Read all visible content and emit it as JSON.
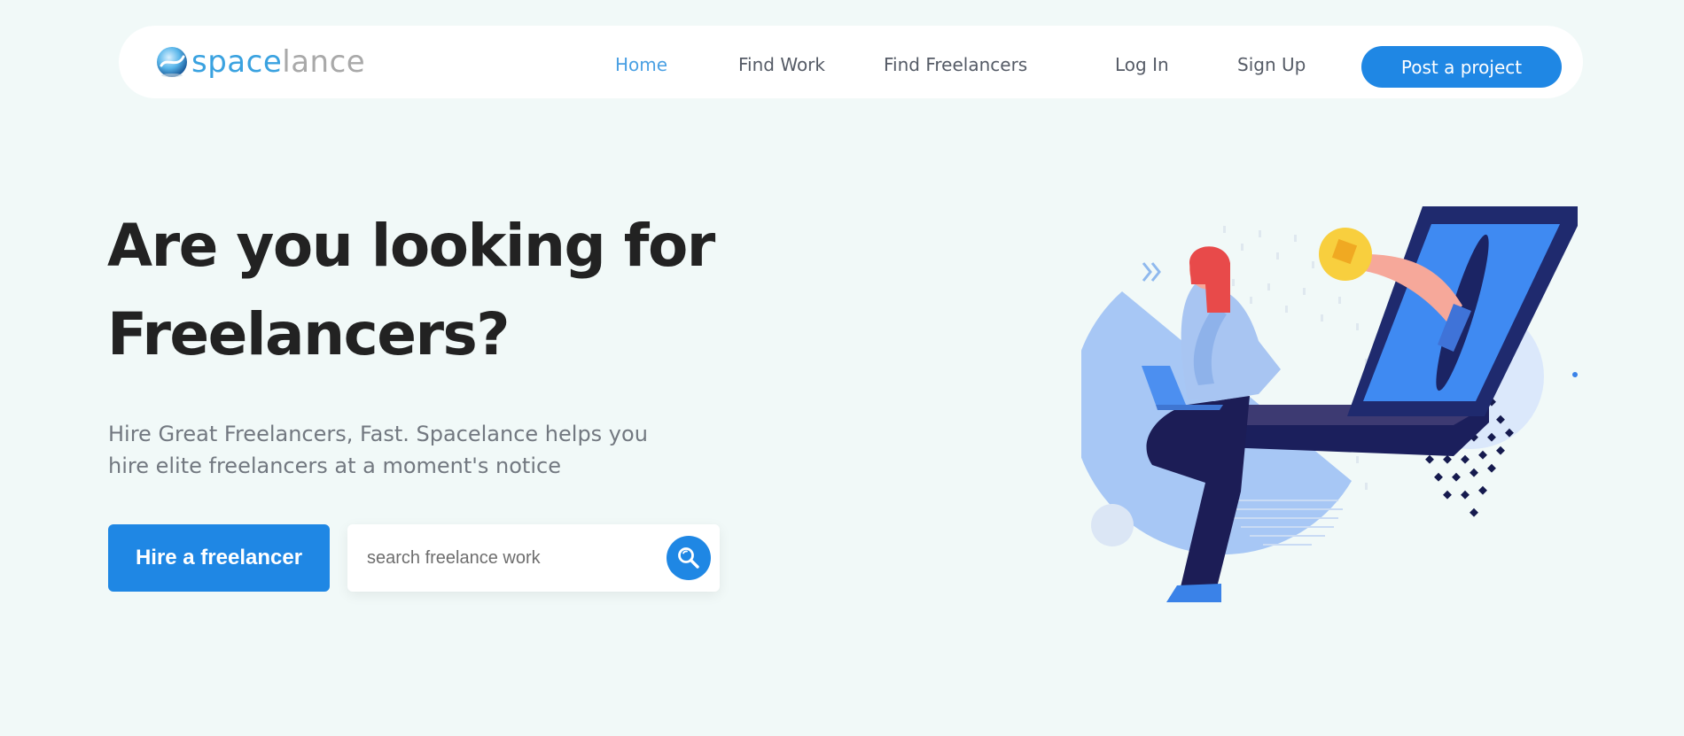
{
  "brand": {
    "part1": "space",
    "part2": "lance",
    "colors": {
      "part1": "#3aa2e0",
      "part2": "#a9a9a9"
    },
    "icon": "globe-logo-icon"
  },
  "nav": {
    "items": [
      {
        "label": "Home",
        "active": true
      },
      {
        "label": "Find Work",
        "active": false
      },
      {
        "label": "Find Freelancers",
        "active": false
      },
      {
        "label": "Log In",
        "active": false
      },
      {
        "label": "Sign Up",
        "active": false
      }
    ],
    "cta_label": "Post a project"
  },
  "hero": {
    "title_line1": "Are you looking for",
    "title_line2": "Freelancers?",
    "subtitle_line1": "Hire Great Freelancers, Fast. Spacelance helps you",
    "subtitle_line2": "hire elite freelancers at a moment's notice",
    "hire_button": "Hire a freelancer",
    "search": {
      "placeholder": "search freelance work",
      "value": "",
      "icon": "search-icon"
    }
  },
  "colors": {
    "background": "#f1f9f8",
    "accent": "#1f87e4",
    "active_link": "#4aa0e3",
    "heading": "#222222",
    "body_text": "#727880"
  }
}
